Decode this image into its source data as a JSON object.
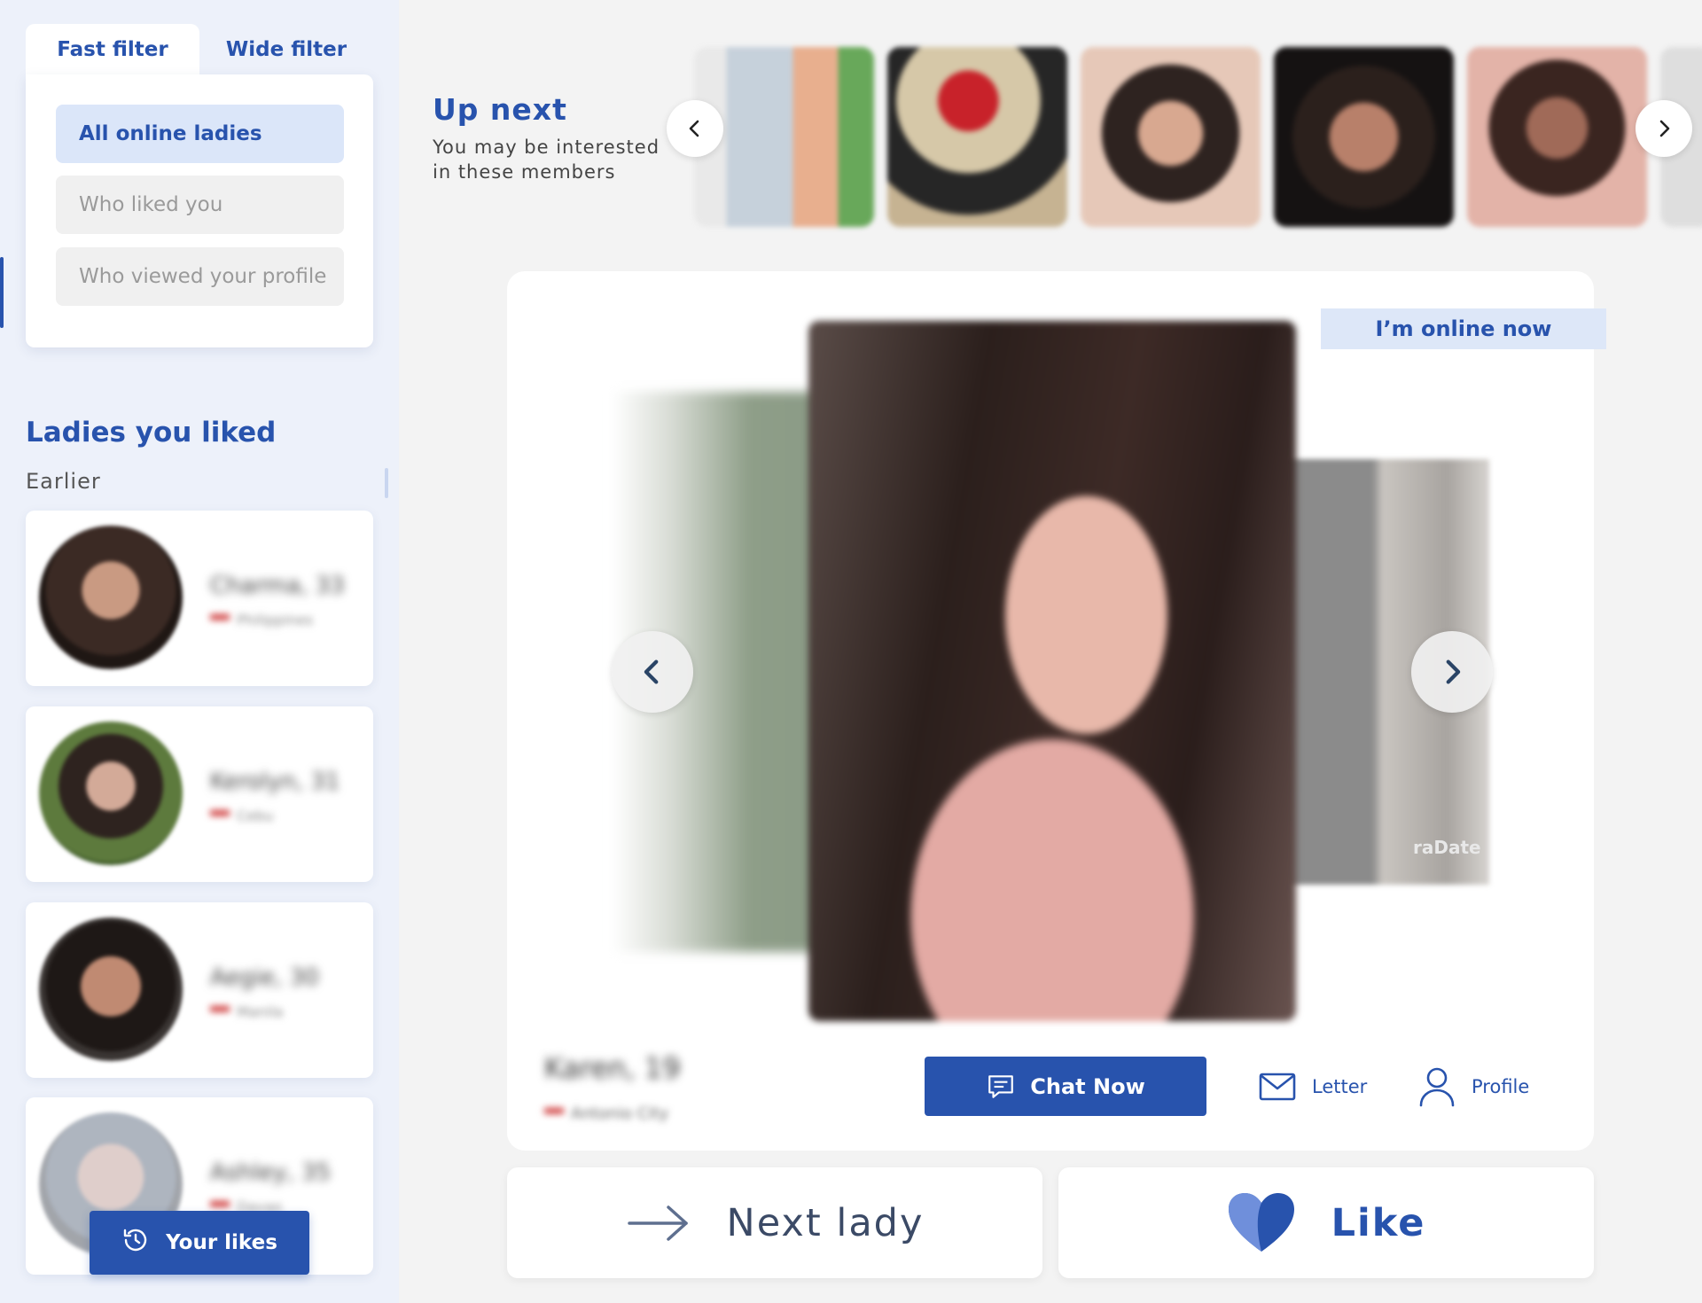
{
  "filters": {
    "tabs": [
      "Fast filter",
      "Wide filter"
    ],
    "options": [
      "All online ladies",
      "Who liked you",
      "Who viewed your profile"
    ]
  },
  "liked": {
    "title": "Ladies you liked",
    "section": "Earlier",
    "cards": [
      {
        "name": "Charma, 33",
        "location": "Philippines"
      },
      {
        "name": "Kerolyn, 31",
        "location": "Cebu"
      },
      {
        "name": "Aegie, 30",
        "location": "Manila"
      },
      {
        "name": "Ashley, 35",
        "location": "Davao"
      }
    ],
    "your_likes_label": "Your likes"
  },
  "upnext": {
    "title": "Up next",
    "subtitle": "You may be interested in these members",
    "thumb_count": 6
  },
  "profile": {
    "online_badge": "I’m online now",
    "watermark": "raDate",
    "name": "Karen, 19",
    "location": "Antonio City",
    "chat_label": "Chat Now",
    "letter_label": "Letter",
    "profile_label": "Profile"
  },
  "actions": {
    "next_label": "Next lady",
    "like_label": "Like"
  },
  "colors": {
    "accent": "#2853ad",
    "background": "#f3f3f3",
    "sidebar": "#edf1fa",
    "badge": "#dde7f8"
  }
}
